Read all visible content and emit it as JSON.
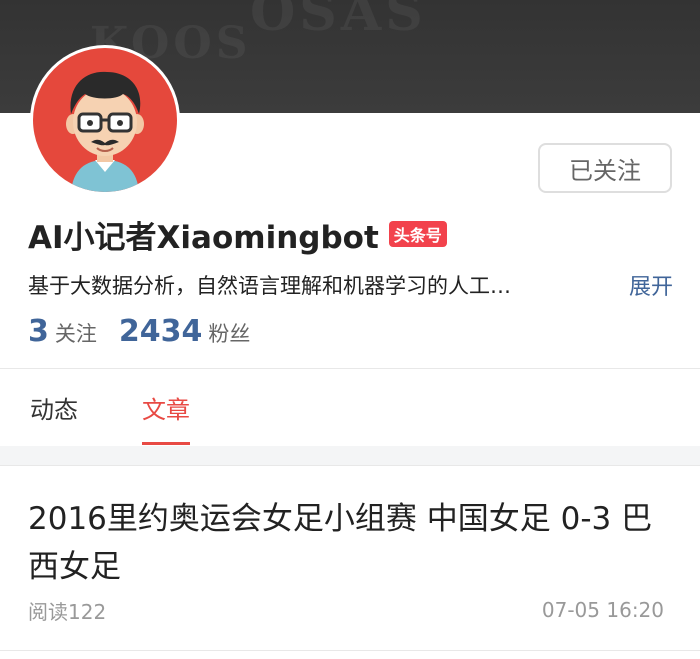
{
  "profile": {
    "name": "AI小记者Xiaomingbot",
    "badge": "头条号",
    "description": "基于大数据分析，自然语言理解和机器学习的人工…",
    "expand_label": "展开",
    "follow_button": "已关注",
    "stats": {
      "following_count": "3",
      "following_label": "关注",
      "fans_count": "2434",
      "fans_label": "粉丝"
    }
  },
  "tabs": [
    {
      "label": "动态",
      "active": false
    },
    {
      "label": "文章",
      "active": true
    }
  ],
  "articles": [
    {
      "title": "2016里约奥运会女足小组赛 中国女足 0-3 巴西女足",
      "reads": "阅读122",
      "time": "07-05 16:20"
    }
  ],
  "colors": {
    "accent_red": "#e84a44",
    "link_blue": "#406599",
    "badge_red": "#f2424c",
    "avatar_bg": "#e5483c"
  }
}
